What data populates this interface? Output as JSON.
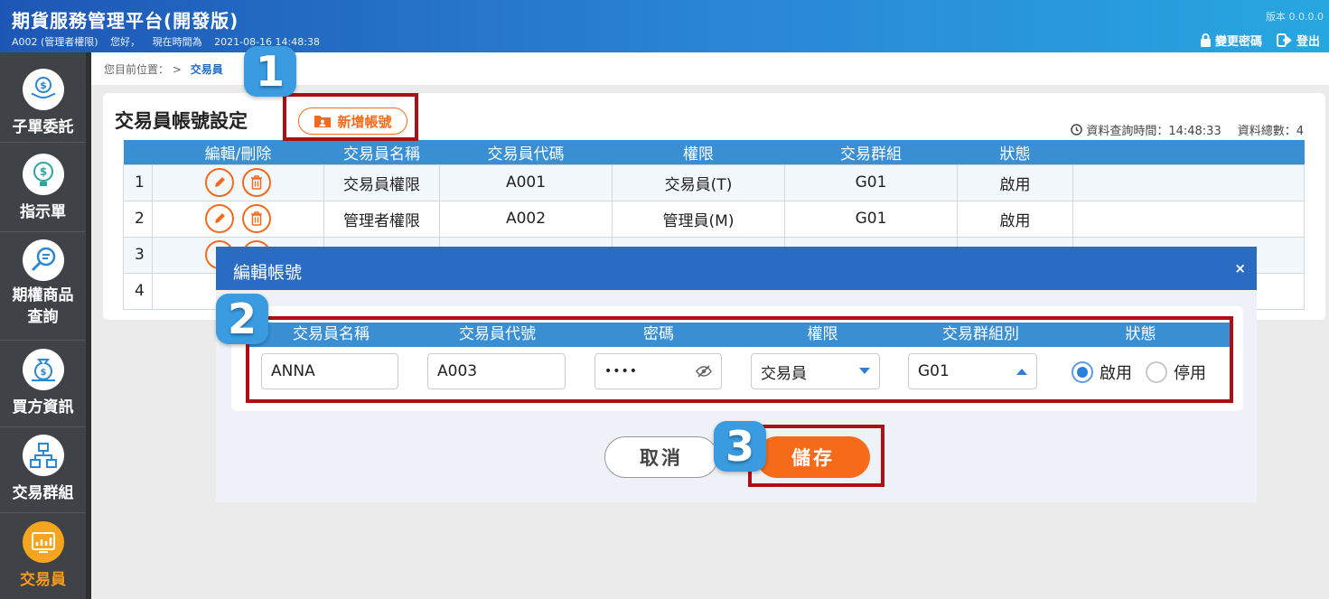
{
  "header": {
    "title": "期貨服務管理平台(開發版)",
    "user": "A002 (管理者權限)",
    "greeting": "您好，",
    "time_label": "現在時間為",
    "time": "2021-08-16 14:48:38",
    "version": "版本 0.0.0.0",
    "change_password": "變更密碼",
    "logout": "登出"
  },
  "sidebar": {
    "items": [
      {
        "label": "子單委託",
        "icon": "hand-money-icon"
      },
      {
        "label": "指示單",
        "icon": "money-bulb-icon"
      },
      {
        "label": "期權商品查詢",
        "icon": "search-chat-icon"
      },
      {
        "label": "買方資訊",
        "icon": "moneybag-hand-icon"
      },
      {
        "label": "交易群組",
        "icon": "org-chart-icon"
      },
      {
        "label": "交易員",
        "icon": "chart-board-icon",
        "active": true
      }
    ],
    "accent": "#f59a1b"
  },
  "breadcrumb": {
    "prefix": "您目前位置：",
    "separator": ">",
    "current": "交易員"
  },
  "page": {
    "title": "交易員帳號設定",
    "add_button": "新增帳號",
    "query_time_label": "資料查詢時間：14:48:33",
    "total_label": "資料總數：4"
  },
  "table": {
    "columns": [
      "",
      "編輯/刪除",
      "交易員名稱",
      "交易員代碼",
      "權限",
      "交易群組",
      "狀態",
      ""
    ],
    "rows": [
      {
        "no": "1",
        "name": "交易員權限",
        "code": "A001",
        "role": "交易員(T)",
        "group": "G01",
        "status": "啟用"
      },
      {
        "no": "2",
        "name": "管理者權限",
        "code": "A002",
        "role": "管理員(M)",
        "group": "G01",
        "status": "啟用"
      },
      {
        "no": "3"
      },
      {
        "no": "4"
      }
    ]
  },
  "modal": {
    "title": "編輯帳號",
    "close": "×",
    "columns": [
      "交易員名稱",
      "交易員代號",
      "密碼",
      "權限",
      "交易群組別",
      "狀態"
    ],
    "name_value": "ANNA",
    "code_value": "A003",
    "password_value": "••••",
    "role_value": "交易員",
    "group_value": "G01",
    "status_on": "啟用",
    "status_off": "停用",
    "cancel": "取消",
    "save": "儲存"
  },
  "steps": [
    "1",
    "2",
    "3"
  ],
  "colors": {
    "brand_blue": "#2a6cc4",
    "table_header": "#3a8fd3",
    "orange": "#f56b1a",
    "highlight_red": "#ad0f13"
  }
}
